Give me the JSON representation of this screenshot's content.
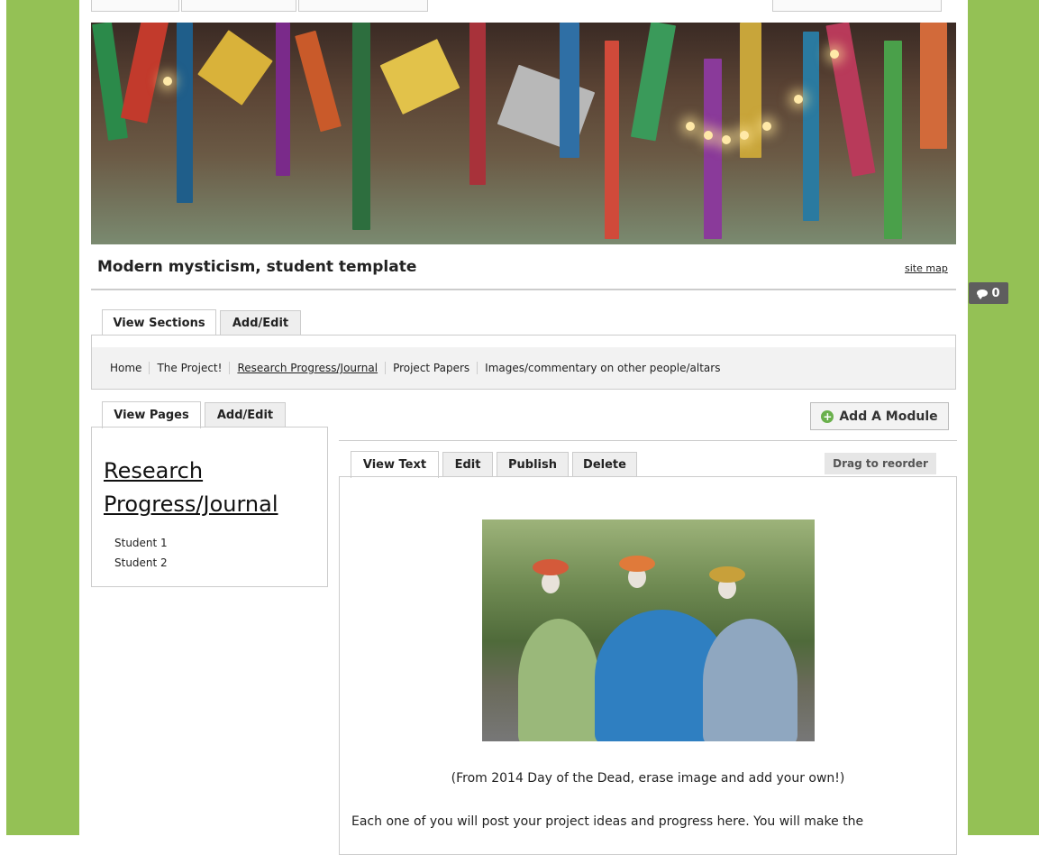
{
  "site": {
    "title": "Modern mysticism, student template",
    "site_map_label": "site map"
  },
  "comments": {
    "count": "0"
  },
  "section_tabs": {
    "view": "View Sections",
    "add_edit": "Add/Edit"
  },
  "sections": [
    {
      "label": "Home"
    },
    {
      "label": "The Project!"
    },
    {
      "label": "Research Progress/Journal"
    },
    {
      "label": "Project Papers"
    },
    {
      "label": "Images/commentary on other people/altars"
    }
  ],
  "page_tabs": {
    "view": "View Pages",
    "add_edit": "Add/Edit"
  },
  "pages": {
    "heading_line1": "Research",
    "heading_line2": "Progress/Journal",
    "subpages": [
      "Student 1",
      "Student 2"
    ]
  },
  "module": {
    "add_label": "Add A Module",
    "tabs": [
      "View Text",
      "Edit",
      "Publish",
      "Delete"
    ],
    "drag_label": "Drag to reorder",
    "caption": "(From 2014 Day of the Dead, erase image and add your own!)",
    "body": "Each one of you will post your project ideas and progress here.  You will make the"
  },
  "colors": {
    "frame_green": "#94c155",
    "badge_gray": "#5e5e5e",
    "plus_green": "#6ab04c"
  },
  "icons": [
    "speech-bubble-icon",
    "plus-circle-icon"
  ]
}
